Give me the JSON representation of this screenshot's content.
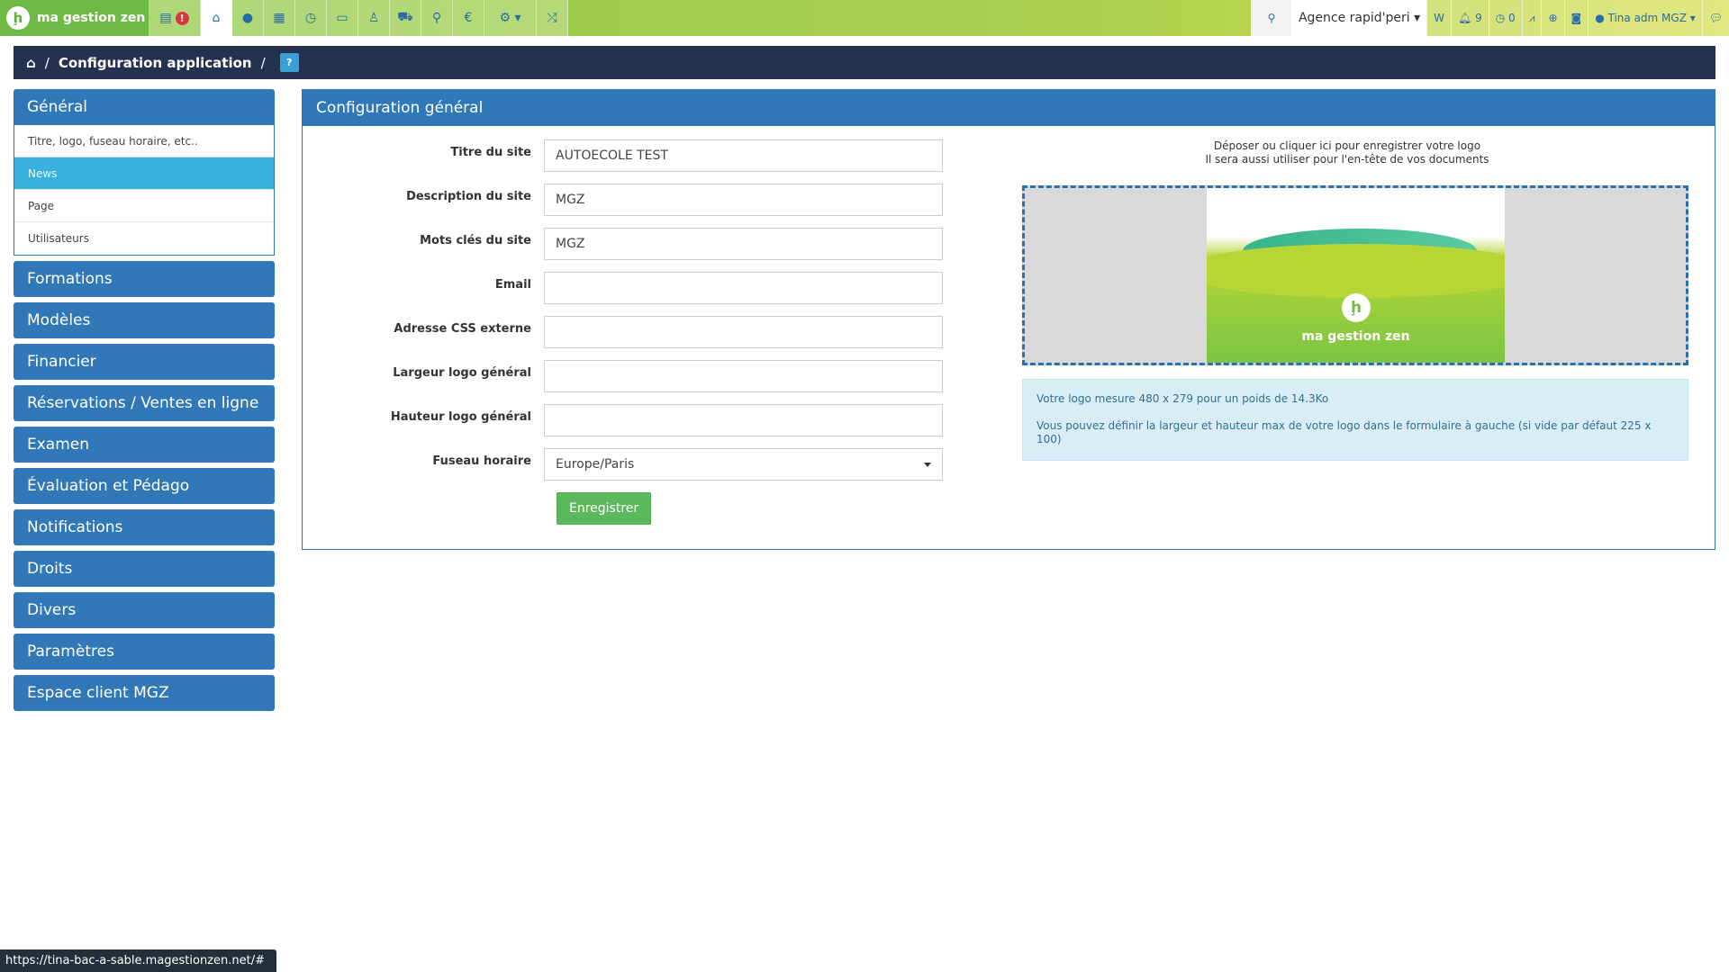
{
  "topbar": {
    "brand": "ma gestion zen",
    "brand_mark": "ḩ",
    "alert_count": "!",
    "icons": [
      "home-icon",
      "user-icon",
      "calendar-icon",
      "clock-icon",
      "card-icon",
      "person-icon",
      "car-icon",
      "map-pin-icon",
      "euro-icon",
      "cogs-icon",
      "shuffle-icon"
    ],
    "agency": "Agence rapid'peri",
    "w_label": "W",
    "bell_count": "9",
    "clock_count": "0",
    "user": "Tina adm MGZ"
  },
  "breadcrumb": {
    "home": "⌂",
    "sep": "/",
    "current": "Configuration application",
    "help": "?"
  },
  "sidebar": {
    "group_title": "Général",
    "sub_items": [
      {
        "label": "Titre, logo, fuseau horaire, etc..",
        "active": false
      },
      {
        "label": "News",
        "active": true
      },
      {
        "label": "Page",
        "active": false
      },
      {
        "label": "Utilisateurs",
        "active": false
      }
    ],
    "buttons": [
      "Formations",
      "Modèles",
      "Financier",
      "Réservations / Ventes en ligne",
      "Examen",
      "Évaluation et Pédago",
      "Notifications",
      "Droits",
      "Divers",
      "Paramètres",
      "Espace client MGZ"
    ]
  },
  "panel": {
    "title": "Configuration général",
    "fields": [
      {
        "label": "Titre du site",
        "value": "AUTOECOLE TEST"
      },
      {
        "label": "Description du site",
        "value": "MGZ"
      },
      {
        "label": "Mots clés du site",
        "value": "MGZ"
      },
      {
        "label": "Email",
        "value": ""
      },
      {
        "label": "Adresse CSS externe",
        "value": ""
      },
      {
        "label": "Largeur logo général",
        "value": ""
      },
      {
        "label": "Hauteur logo général",
        "value": ""
      }
    ],
    "timezone": {
      "label": "Fuseau horaire",
      "value": "Europe/Paris"
    },
    "save_label": "Enregistrer",
    "upload_line1": "Déposer ou cliquer ici pour enregistrer votre logo",
    "upload_line2": "Il sera aussi utiliser pour l'en-tête de vos documents",
    "preview_brand": "ma gestion zen",
    "preview_mark": "ḩ",
    "info_line1": "Votre logo mesure 480 x 279 pour un poids de 14.3Ko",
    "info_line2": "Vous pouvez définir la largeur et hauteur max de votre logo dans le formulaire à gauche (si vide par défaut 225 x 100)"
  },
  "statusbar": {
    "url": "https://tina-bac-a-sable.magestionzen.net/#"
  },
  "colors": {
    "primary": "#3078b8",
    "navy": "#24324f",
    "active_sub": "#3ab0dc",
    "success": "#5cb85c",
    "info_bg": "#d9edf7"
  }
}
